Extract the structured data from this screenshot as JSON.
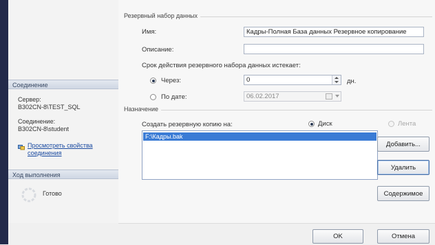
{
  "sidebar": {
    "connection_header": "Соединение",
    "server_label": "Сервер:",
    "server_value": "B302CN-8\\TEST_SQL",
    "connection_label": "Соединение:",
    "connection_value": "B302CN-8\\student",
    "view_link_line1": "Просмотреть свойства",
    "view_link_line2": "соединения",
    "progress_header": "Ход выполнения",
    "progress_status": "Готово"
  },
  "backup_set": {
    "group_label": "Резервный набор данных",
    "name_label": "Имя:",
    "name_value": "Кадры-Полная База данных Резервное копирование",
    "description_label": "Описание:",
    "description_value": "",
    "expires_label": "Срок действия резервного набора данных истекает:",
    "after_label": "Через:",
    "after_value": "0",
    "after_unit": "дн.",
    "on_date_label": "По дате:",
    "on_date_value": "06.02.2017"
  },
  "destination": {
    "group_label": "Назначение",
    "backup_to_label": "Создать резервную копию на:",
    "disk_label": "Диск",
    "tape_label": "Лента",
    "files": [
      "F:\\Кадры.bak"
    ],
    "add_button": "Добавить...",
    "remove_button": "Удалить",
    "contents_button": "Содержимое"
  },
  "footer": {
    "ok_button": "OK",
    "cancel_button": "Отмена"
  }
}
